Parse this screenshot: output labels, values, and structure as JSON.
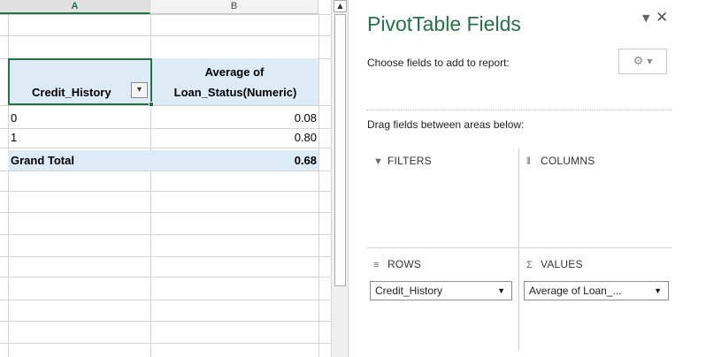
{
  "sheet": {
    "columns": [
      "A",
      "B"
    ],
    "pivot": {
      "row_header": "Credit_History",
      "value_header_line1": "Average of",
      "value_header_line2": "Loan_Status(Numeric)",
      "filter_icon": "filter-dropdown-icon",
      "rows": [
        {
          "label": "0",
          "value": "0.08"
        },
        {
          "label": "1",
          "value": "0.80"
        }
      ],
      "total": {
        "label": "Grand Total",
        "value": "0.68"
      }
    }
  },
  "scrollbar": {
    "up_arrow_icon": "scroll-up-arrow-icon"
  },
  "pane": {
    "title": "PivotTable Fields",
    "choose_label": "Choose fields to add to report:",
    "drag_label": "Drag fields between areas below:",
    "areas": {
      "filters": "FILTERS",
      "columns": "COLUMNS",
      "rows": "ROWS",
      "values": "VALUES"
    },
    "row_field": "Credit_History",
    "value_field": "Average of Loan_...",
    "icons": {
      "filters": "filter-funnel-icon",
      "columns": "columns-bars-icon",
      "rows": "rows-lines-icon",
      "values": "sigma-icon",
      "tools": "gear-icon",
      "close": "close-icon",
      "dropdown": "pane-options-arrow-icon"
    },
    "colors": {
      "accent": "#217346",
      "header_fill": "#ddebf7"
    }
  }
}
